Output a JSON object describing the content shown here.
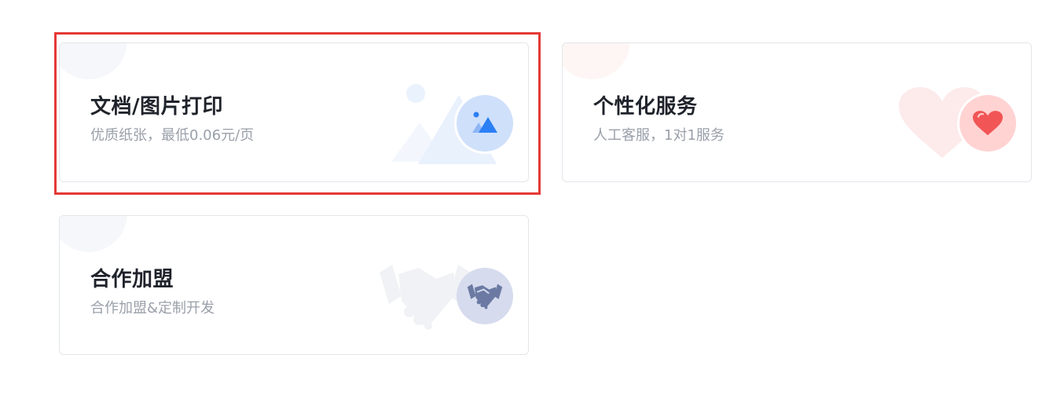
{
  "cards": [
    {
      "title": "文档/图片打印",
      "subtitle": "优质纸张，最低0.06元/页",
      "icon": "image-icon",
      "accent": "#2b7ff5",
      "selected": true
    },
    {
      "title": "个性化服务",
      "subtitle": "人工客服，1对1服务",
      "icon": "heart-icon",
      "accent": "#f25555",
      "selected": false
    },
    {
      "title": "合作加盟",
      "subtitle": "合作加盟&定制开发",
      "icon": "handshake-icon",
      "accent": "#6c7aa3",
      "selected": false
    }
  ],
  "highlight_color": "#e53935"
}
